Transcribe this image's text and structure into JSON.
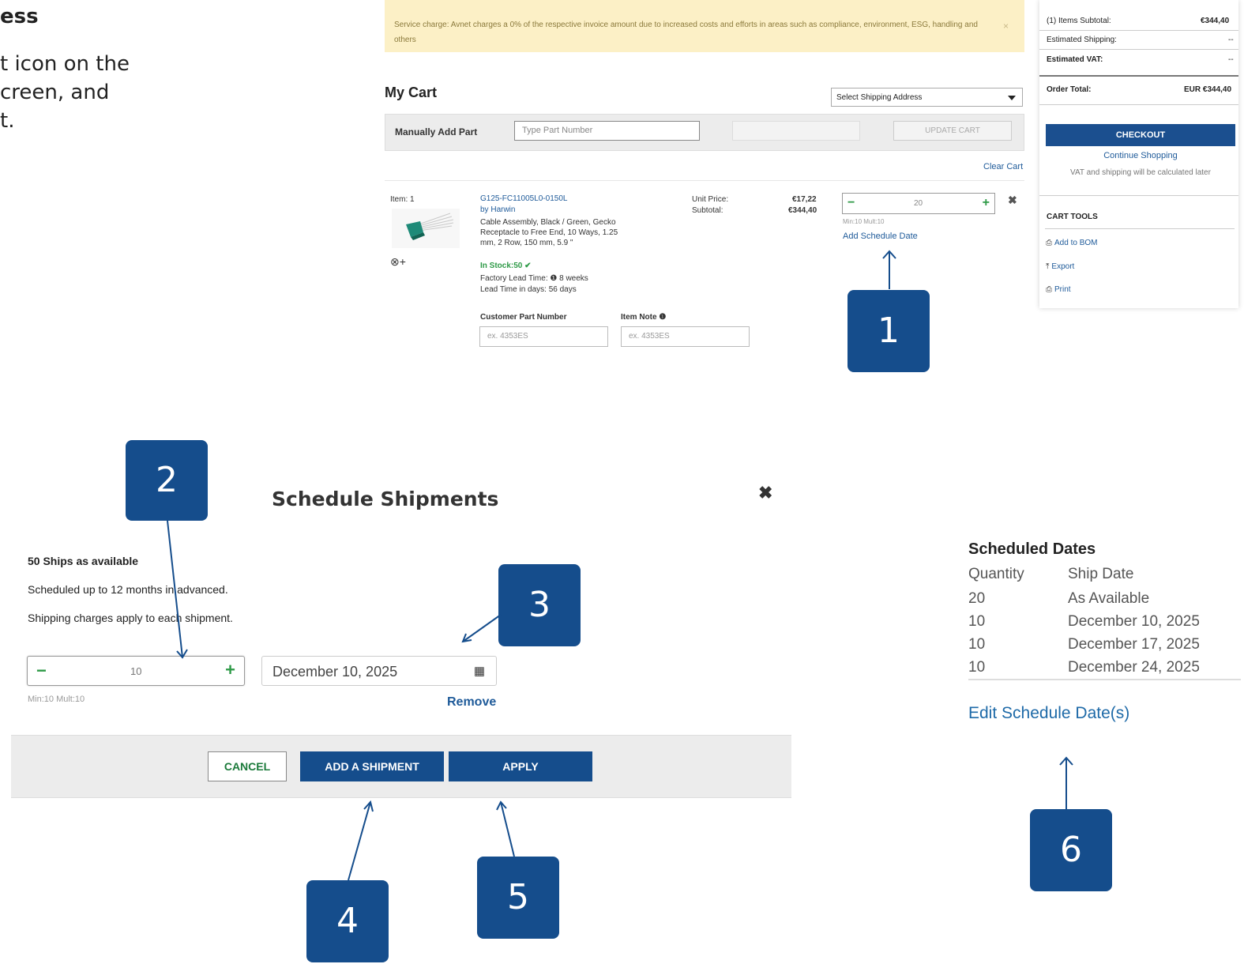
{
  "instructions": {
    "title": "ess",
    "line1": "t icon on the",
    "line2": "creen, and",
    "line3": "t."
  },
  "banner": {
    "text": "Service charge: Avnet charges a 0% of the respective invoice amount due to increased costs and efforts in areas such as compliance, environment, ESG, handling and others",
    "close": "×"
  },
  "cart": {
    "title": "My Cart",
    "shipping_select": "Select Shipping Address",
    "manual_add_label": "Manually Add Part",
    "part_placeholder": "Type Part Number",
    "update_label": "UPDATE CART",
    "clear_label": "Clear Cart"
  },
  "item": {
    "label": "Item: 1",
    "part_number": "G125-FC11005L0-0150L",
    "by": "by",
    "manufacturer": "Harwin",
    "description": "Cable Assembly, Black / Green, Gecko Receptacle to Free End, 10 Ways, 1.25 mm, 2 Row, 150 mm, 5.9 \"",
    "in_stock": "In Stock:50 ✔",
    "factory_lead": "Factory Lead Time:  ❶  8 weeks",
    "lead_days": "Lead Time in days:  56 days",
    "unit_price_label": "Unit Price:",
    "subtotal_label": "Subtotal:",
    "unit_price": "€17,22",
    "subtotal": "€344,40",
    "qty": "20",
    "min_mult": "Min:10  Mult:10",
    "add_schedule": "Add Schedule Date",
    "cpn_label": "Customer Part Number",
    "note_label": "Item Note ❶",
    "cpn_placeholder": "ex. 4353ES",
    "note_placeholder": "ex. 4353ES",
    "plus_icon": "⊗+",
    "remove_icon": "✖"
  },
  "summary": {
    "subtotal_label": "(1) Items Subtotal:",
    "subtotal": "€344,40",
    "shipping_label": "Estimated Shipping:",
    "shipping": "--",
    "vat_label": "Estimated VAT:",
    "vat": "--",
    "total_label": "Order Total:",
    "total": "EUR €344,40",
    "checkout": "CHECKOUT",
    "continue": "Continue Shopping",
    "vat_note": "VAT and shipping will be calculated later",
    "tools_title": "CART TOOLS",
    "tools": [
      "Add to BOM",
      "Export",
      "Print"
    ]
  },
  "callouts": [
    "1",
    "2",
    "3",
    "4",
    "5",
    "6"
  ],
  "modal": {
    "title": "Schedule Shipments",
    "close": "✖",
    "available": "50 Ships as available",
    "scheduled_note": "Scheduled up to 12 months in advanced.",
    "charges_note": "Shipping charges apply to each shipment.",
    "qty": "10",
    "min_mult": "Min:10  Mult:10",
    "date": "December 10, 2025",
    "remove": "Remove",
    "cancel": "CANCEL",
    "add_shipment": "ADD A SHIPMENT",
    "apply": "APPLY"
  },
  "scheduled": {
    "title": "Scheduled Dates",
    "headers": [
      "Quantity",
      "Ship Date"
    ],
    "rows": [
      [
        "20",
        "As Available"
      ],
      [
        "10",
        "December 10, 2025"
      ],
      [
        "10",
        "December 17, 2025"
      ],
      [
        "10",
        "December 24, 2025"
      ]
    ],
    "edit": "Edit Schedule Date(s)"
  },
  "colors": {
    "brand_blue": "#154d8c",
    "link_blue": "#1e5a99",
    "stepper_green": "#2e9a47",
    "banner_bg": "#fcf0c6"
  }
}
